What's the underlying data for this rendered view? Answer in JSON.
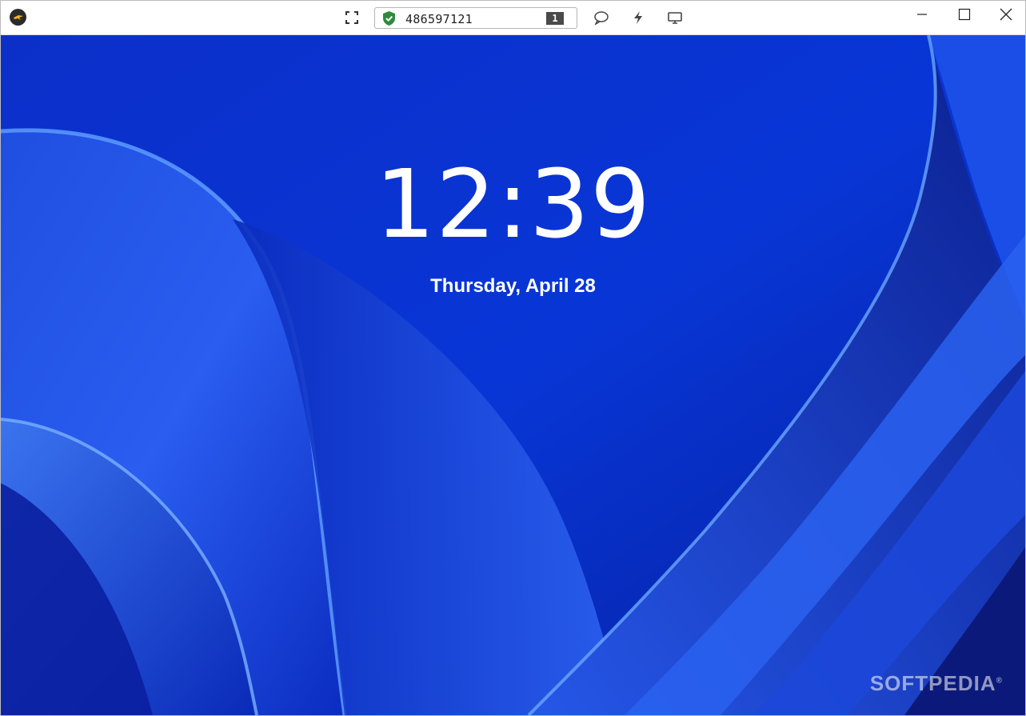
{
  "toolbar": {
    "session_id": "486597121",
    "display_number": "1",
    "icons": [
      "app-logo-icon",
      "fullscreen-icon",
      "shield-check-icon",
      "chat-icon",
      "lightning-icon",
      "monitor-icon"
    ]
  },
  "window_controls": {
    "minimize": "minimize-icon",
    "maximize": "maximize-icon",
    "close": "close-icon"
  },
  "lockscreen": {
    "time": "12:39",
    "date": "Thursday, April 28"
  },
  "watermark": {
    "text": "SOFTPEDIA",
    "mark": "®"
  },
  "colors": {
    "wallpaper_base": "#0a2fd0",
    "shield_green": "#2e8b3d",
    "badge_gray": "#4a4a4a"
  }
}
